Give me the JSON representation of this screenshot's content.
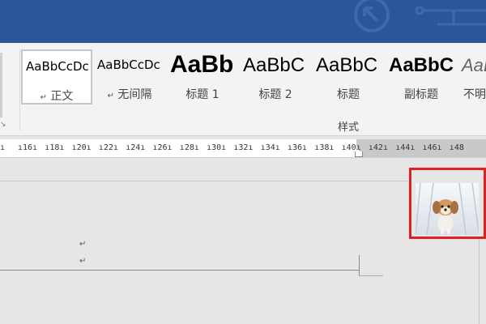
{
  "ribbon": {
    "styles": [
      {
        "sample": "AaBbCcDc",
        "name": "正文",
        "mark": "↵",
        "selected": true
      },
      {
        "sample": "AaBbCcDc",
        "name": "无间隔",
        "mark": "↵",
        "selected": false
      },
      {
        "sample": "AaBb",
        "name": "标题 1",
        "mark": "",
        "selected": false
      },
      {
        "sample": "AaBbC",
        "name": "标题 2",
        "mark": "",
        "selected": false
      },
      {
        "sample": "AaBbC",
        "name": "标题",
        "mark": "",
        "selected": false
      },
      {
        "sample": "AaBbC",
        "name": "副标题",
        "mark": "",
        "selected": false
      },
      {
        "sample": "AaBbC",
        "name": "不明",
        "mark": "",
        "selected": false
      }
    ],
    "group_label": "样式"
  },
  "ruler": {
    "numbers": [
      "16",
      "18",
      "20",
      "22",
      "24",
      "26",
      "28",
      "30",
      "32",
      "34",
      "36",
      "38",
      "40",
      "42",
      "44",
      "46",
      "48"
    ]
  },
  "document": {
    "paragraph_marks": [
      "↵",
      "↵"
    ],
    "image_icon": "puppy-photo"
  },
  "colors": {
    "titlebar": "#2b579a",
    "ribbon": "#f3f3f3",
    "highlight": "#e02020"
  }
}
